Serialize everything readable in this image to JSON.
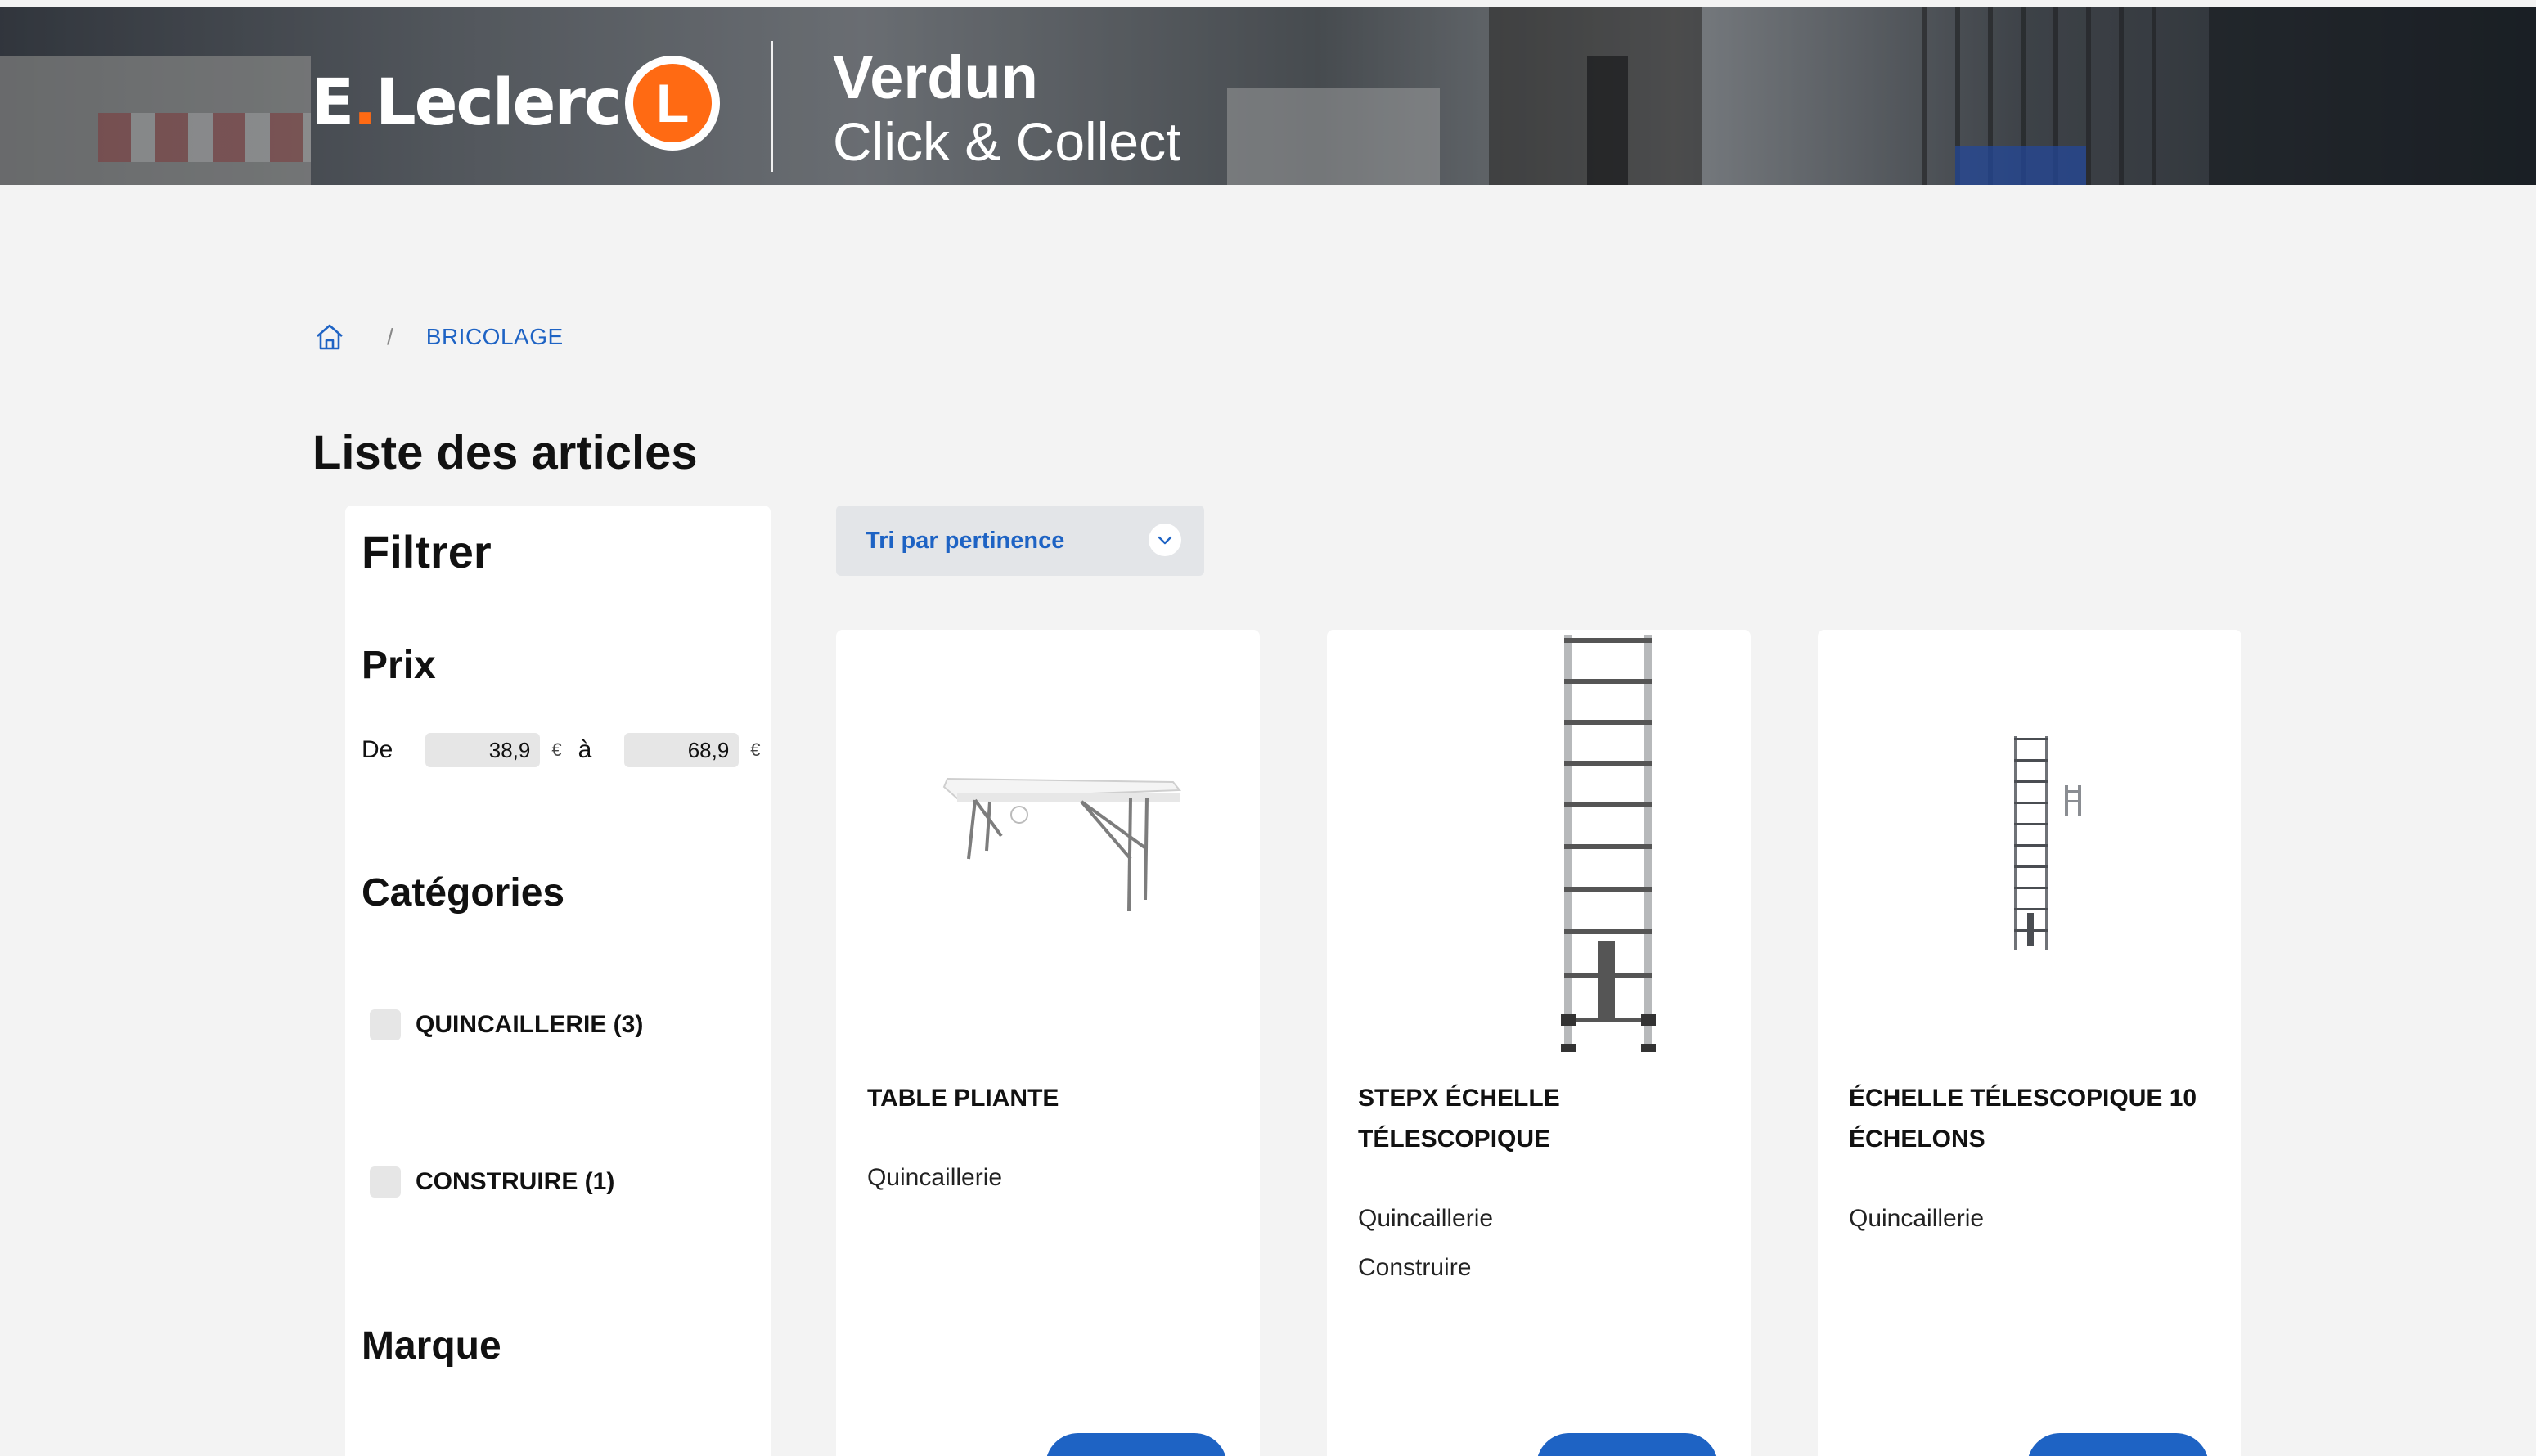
{
  "header": {
    "brand_name_part1": "E",
    "brand_name_dot": ".",
    "brand_name_part2": "Leclerc",
    "logo_letter": "L",
    "store_city": "Verdun",
    "store_service": "Click & Collect",
    "brand_color": "#ff6a13"
  },
  "breadcrumb": {
    "home_icon": "home-icon",
    "separator": "/",
    "current": "BRICOLAGE"
  },
  "page": {
    "title": "Liste des articles"
  },
  "filters": {
    "title": "Filtrer",
    "price": {
      "title": "Prix",
      "from_label": "De",
      "min_value": "38,9",
      "to_label": "à",
      "max_value": "68,9",
      "currency": "€"
    },
    "categories": {
      "title": "Catégories",
      "items": [
        {
          "label": "QUINCAILLERIE (3)",
          "checked": false
        },
        {
          "label": "CONSTRUIRE (1)",
          "checked": false
        }
      ]
    },
    "brand": {
      "title": "Marque"
    }
  },
  "sort": {
    "label": "Tri par pertinence",
    "icon": "chevron-down-icon"
  },
  "products": [
    {
      "name": "TABLE PLIANTE",
      "categories": [
        "Quincaillerie"
      ],
      "image": "folding-table"
    },
    {
      "name": "STEPX ÉCHELLE TÉLESCOPIQUE",
      "categories": [
        "Quincaillerie",
        "Construire"
      ],
      "image": "telescopic-ladder"
    },
    {
      "name": "ÉCHELLE TÉLESCOPIQUE 10 ÉCHELONS",
      "categories": [
        "Quincaillerie"
      ],
      "image": "telescopic-ladder-small"
    }
  ],
  "colors": {
    "accent": "#1e63c4",
    "background": "#f3f3f3",
    "card": "#ffffff"
  }
}
